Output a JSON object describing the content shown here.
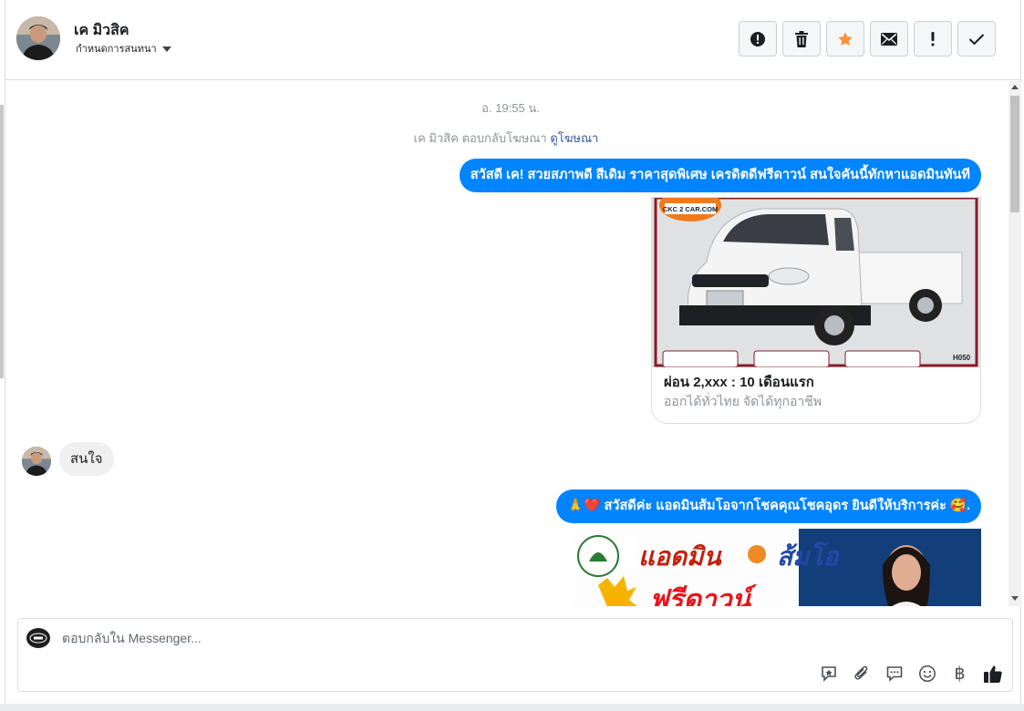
{
  "header": {
    "contact_name": "เค มิวสิค",
    "assign_label": "กำหนดการสนทนา",
    "actions": [
      {
        "icon": "alert-circle-icon",
        "name": "mark-spam-button"
      },
      {
        "icon": "trash-icon",
        "name": "delete-button"
      },
      {
        "icon": "star-icon",
        "name": "star-button"
      },
      {
        "icon": "envelope-icon",
        "name": "mark-unread-button"
      },
      {
        "icon": "exclamation-icon",
        "name": "follow-up-button"
      },
      {
        "icon": "checkmark-icon",
        "name": "mark-done-button"
      }
    ],
    "star_color": "#f7923b"
  },
  "conversation": {
    "timestamp": "อ. 19:55 น.",
    "ad_reply_text": "เค มิวสิค ตอบกลับโฆษณา",
    "ad_reply_link": "ดูโฆษณา",
    "messages": {
      "outgoing_1": "สวัสดี เค! สวยสภาพดี สีเดิม ราคาสุดพิเศษ เครดิตดีฟรีดาวน์ สนใจคันนี้ทักหาแอดมินทันที",
      "card_title": "ผ่อน 2,xxx : 10 เดือนแรก",
      "card_subtitle": "ออกได้ทั่วไทย จัดได้ทุกอาชีพ",
      "card_logo_text": "CKC 2 CAR.COM",
      "card_code": "H050",
      "incoming_1": "สนใจ",
      "outgoing_2_emoji_start": "🙏❤️",
      "outgoing_2": "สวัสดีค่ะ แอดมินส้มโอจากโชคคุณโชคอุดร ยินดีให้บริการค่ะ",
      "outgoing_2_emoji_end": "🥰.",
      "banner_text_1": "แอดมิน",
      "banner_text_2": "ส้มโอ",
      "banner_text_3": "ฟรีดาวน์"
    },
    "bubble_color": "#0084ff"
  },
  "composer": {
    "placeholder": "ตอบกลับใน Messenger...",
    "tools": [
      "saved-reply-icon",
      "paperclip-icon",
      "chat-bubble-icon",
      "emoji-icon",
      "baht-icon",
      "thumbs-up-icon"
    ],
    "baht_symbol": "฿"
  }
}
